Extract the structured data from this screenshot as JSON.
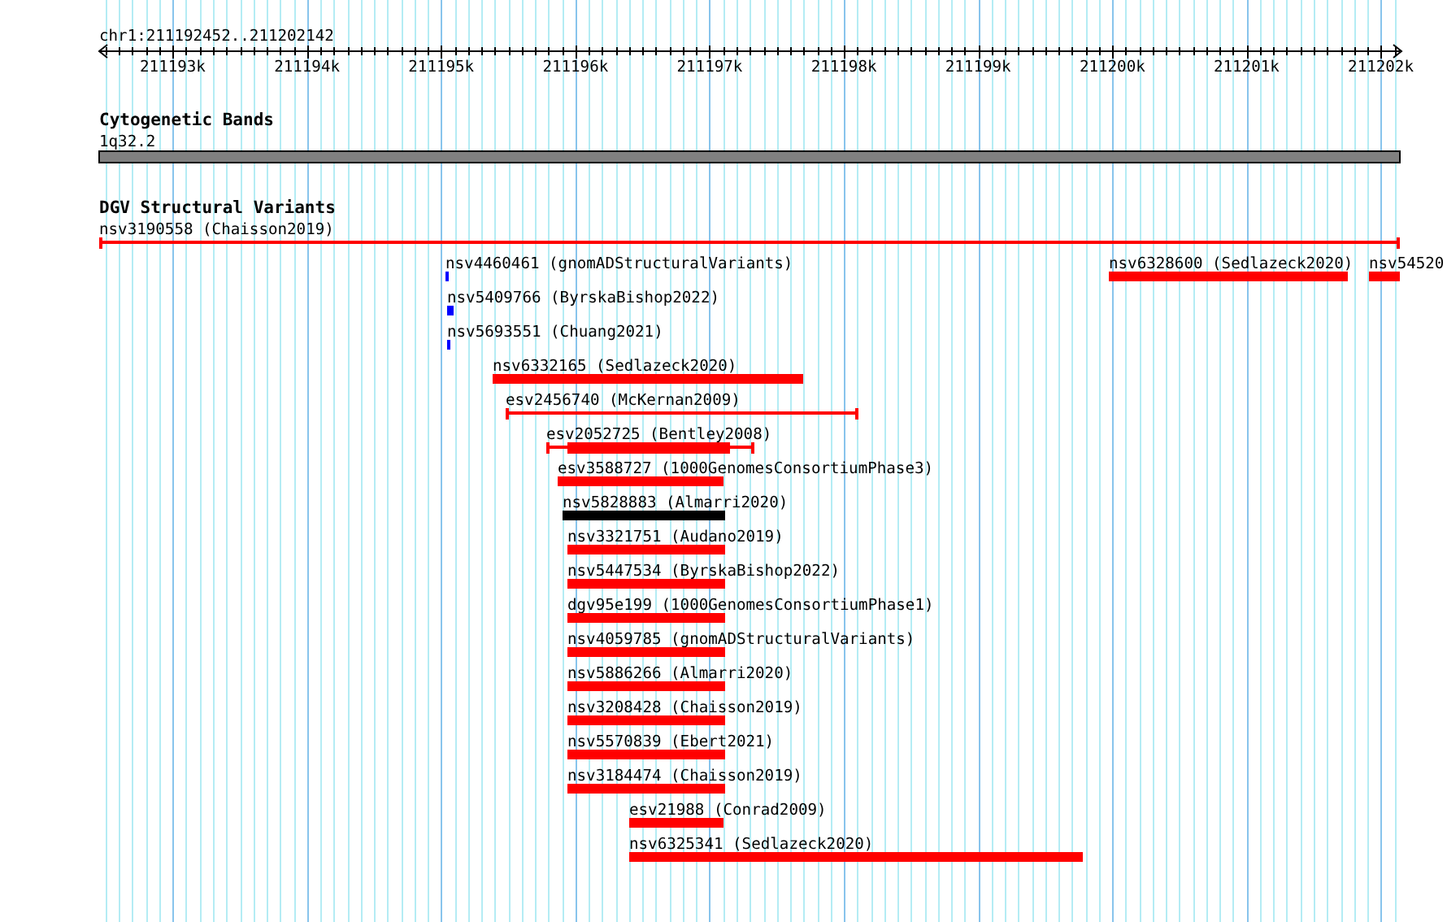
{
  "ruler": {
    "label": "chr1:211192452..211202142",
    "ticks": [
      "211193k",
      "211194k",
      "211195k",
      "211196k",
      "211197k",
      "211198k",
      "211199k",
      "211200k",
      "211201k",
      "211202k"
    ]
  },
  "cytogenetic_bands": {
    "title": "Cytogenetic Bands",
    "band": {
      "label": "1q32.2"
    }
  },
  "dgv_track": {
    "title": "DGV Structural Variants",
    "rows": [
      {
        "features": [
          {
            "label": "nsv3190558 (Chaisson2019)",
            "kind": "span",
            "color": "#ff0000"
          }
        ]
      },
      {
        "features": [
          {
            "label": "nsv4460461 (gnomADStructuralVariants)",
            "kind": "bar",
            "color": "#0000ff"
          },
          {
            "label": "nsv6328600 (Sedlazeck2020)",
            "kind": "bar",
            "color": "#ff0000"
          },
          {
            "label": "nsv54520",
            "kind": "bar",
            "color": "#ff0000"
          }
        ]
      },
      {
        "features": [
          {
            "label": "nsv5409766 (ByrskaBishop2022)",
            "kind": "bar",
            "color": "#0000ff"
          }
        ]
      },
      {
        "features": [
          {
            "label": "nsv5693551 (Chuang2021)",
            "kind": "bar",
            "color": "#0000ff"
          }
        ]
      },
      {
        "features": [
          {
            "label": "nsv6332165 (Sedlazeck2020)",
            "kind": "bar",
            "color": "#ff0000"
          }
        ]
      },
      {
        "features": [
          {
            "label": "esv2456740 (McKernan2009)",
            "kind": "span",
            "color": "#ff0000"
          }
        ]
      },
      {
        "features": [
          {
            "label": "esv2052725 (Bentley2008)",
            "kind": "span-core",
            "color": "#ff0000"
          }
        ]
      },
      {
        "features": [
          {
            "label": "esv3588727 (1000GenomesConsortiumPhase3)",
            "kind": "bar",
            "color": "#ff0000"
          }
        ]
      },
      {
        "features": [
          {
            "label": "nsv5828883 (Almarri2020)",
            "kind": "bar",
            "color": "#000000"
          }
        ]
      },
      {
        "features": [
          {
            "label": "nsv3321751 (Audano2019)",
            "kind": "bar",
            "color": "#ff0000"
          }
        ]
      },
      {
        "features": [
          {
            "label": "nsv5447534 (ByrskaBishop2022)",
            "kind": "bar",
            "color": "#ff0000"
          }
        ]
      },
      {
        "features": [
          {
            "label": "dgv95e199 (1000GenomesConsortiumPhase1)",
            "kind": "bar",
            "color": "#ff0000"
          }
        ]
      },
      {
        "features": [
          {
            "label": "nsv4059785 (gnomADStructuralVariants)",
            "kind": "bar",
            "color": "#ff0000"
          }
        ]
      },
      {
        "features": [
          {
            "label": "nsv5886266 (Almarri2020)",
            "kind": "bar",
            "color": "#ff0000"
          }
        ]
      },
      {
        "features": [
          {
            "label": "nsv3208428 (Chaisson2019)",
            "kind": "bar",
            "color": "#ff0000"
          }
        ]
      },
      {
        "features": [
          {
            "label": "nsv5570839 (Ebert2021)",
            "kind": "bar",
            "color": "#ff0000"
          }
        ]
      },
      {
        "features": [
          {
            "label": "nsv3184474 (Chaisson2019)",
            "kind": "bar",
            "color": "#ff0000"
          }
        ]
      },
      {
        "features": [
          {
            "label": "esv21988 (Conrad2009)",
            "kind": "bar",
            "color": "#ff0000"
          }
        ]
      },
      {
        "features": [
          {
            "label": "nsv6325341 (Sedlazeck2020)",
            "kind": "bar",
            "color": "#ff0000"
          }
        ]
      }
    ]
  }
}
